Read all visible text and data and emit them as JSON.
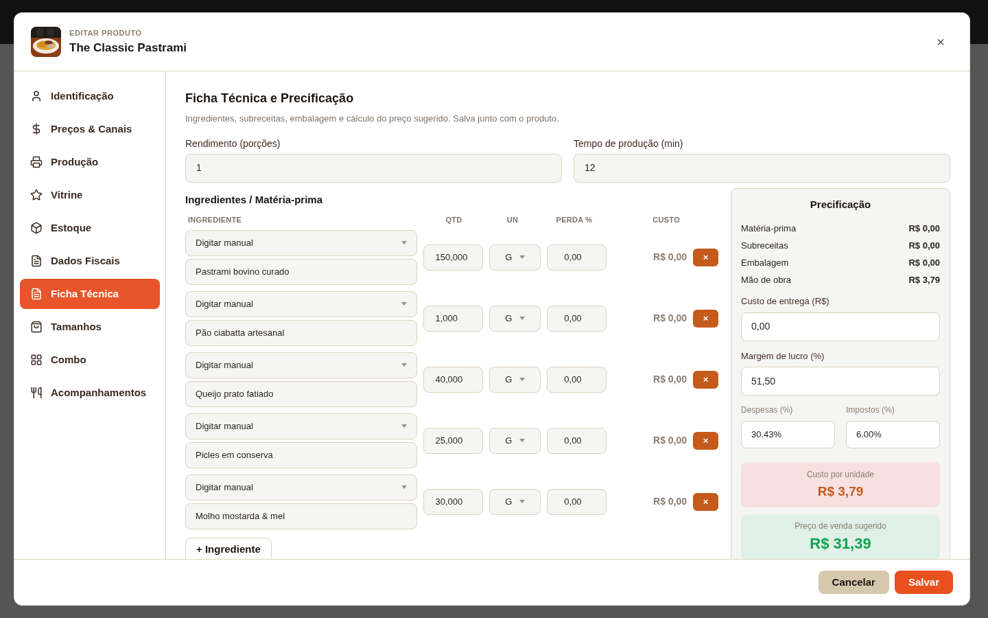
{
  "header": {
    "eyebrow": "EDITAR PRODUTO",
    "title": "The Classic Pastrami",
    "close": "×"
  },
  "sidebar": {
    "items": [
      {
        "label": "Identificação",
        "selected": false
      },
      {
        "label": "Preços & Canais",
        "selected": false
      },
      {
        "label": "Produção",
        "selected": false
      },
      {
        "label": "Vitrine",
        "selected": false
      },
      {
        "label": "Estoque",
        "selected": false
      },
      {
        "label": "Dados Fiscais",
        "selected": false
      },
      {
        "label": "Ficha Técnica",
        "selected": true
      },
      {
        "label": "Tamanhos",
        "selected": false
      },
      {
        "label": "Combo",
        "selected": false
      },
      {
        "label": "Acompanhamentos",
        "selected": false
      }
    ]
  },
  "section": {
    "title": "Ficha Técnica e Precificação",
    "subtitle": "Ingredientes, subreceitas, embalagem e cálculo do preço sugerido. Salva junto com o produto."
  },
  "fields": [
    {
      "label": "Rendimento (porções)",
      "value": "1"
    },
    {
      "label": "Tempo de produção (min)",
      "value": "12"
    }
  ],
  "ingredients": {
    "title": "Ingredientes / Matéria-prima",
    "columns": [
      "INGREDIENTE",
      "QTD",
      "UN",
      "PERDA %",
      "CUSTO"
    ],
    "rows": [
      {
        "source": "Digitar manual",
        "name": "Pastrami bovino curado",
        "qty": "150,000",
        "unit": "G",
        "loss": "0,00",
        "cost": "R$ 0,00",
        "remove": "×"
      },
      {
        "source": "Digitar manual",
        "name": "Pão ciabatta artesanal",
        "qty": "1,000",
        "unit": "G",
        "loss": "0,00",
        "cost": "R$ 0,00",
        "remove": "×"
      },
      {
        "source": "Digitar manual",
        "name": "Queijo prato fatiado",
        "qty": "40,000",
        "unit": "G",
        "loss": "0,00",
        "cost": "R$ 0,00",
        "remove": "×"
      },
      {
        "source": "Digitar manual",
        "name": "Picles em conserva",
        "qty": "25,000",
        "unit": "G",
        "loss": "0,00",
        "cost": "R$ 0,00",
        "remove": "×"
      },
      {
        "source": "Digitar manual",
        "name": "Molho mostarda & mel",
        "qty": "30,000",
        "unit": "G",
        "loss": "0,00",
        "cost": "R$ 0,00",
        "remove": "×"
      }
    ],
    "add_button": "+ Ingrediente"
  },
  "pricing": {
    "title": "Precificação",
    "lines": [
      {
        "label": "Matéria-prima",
        "value": "R$ 0,00"
      },
      {
        "label": "Subreceitas",
        "value": "R$ 0,00"
      },
      {
        "label": "Embalagem",
        "value": "R$ 0,00"
      },
      {
        "label": "Mão de obra",
        "value": "R$ 3,79"
      }
    ],
    "delivery": {
      "label": "Custo de entrega (R$)",
      "value": "0,00"
    },
    "margin": {
      "label": "Margem de lucro (%)",
      "value": "51,50"
    },
    "expenses": {
      "label": "Despesas (%)",
      "value": "30.43%"
    },
    "taxes": {
      "label": "Impostos (%)",
      "value": "6.00%"
    },
    "unit_cost": {
      "label": "Custo por unidade",
      "value": "R$ 3,79"
    },
    "suggested": {
      "label": "Preço de venda sugerido",
      "value": "R$ 31,39"
    }
  },
  "footer": {
    "buttons": [
      {
        "label": "Cancelar",
        "kind": "secondary"
      },
      {
        "label": "Salvar",
        "kind": "primary"
      }
    ]
  }
}
